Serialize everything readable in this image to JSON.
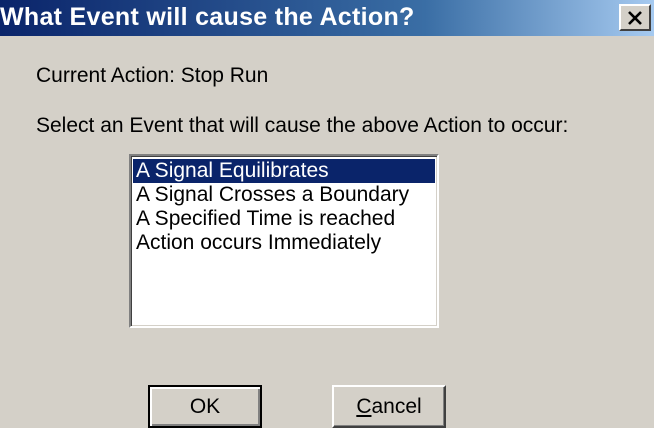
{
  "window": {
    "title": "What Event will cause the Action?",
    "close_icon": "close-icon"
  },
  "dialog": {
    "current_action": "Current Action: Stop Run",
    "select_prompt": "Select an Event that will cause the above Action to occur:"
  },
  "event_list": {
    "selected_index": 0,
    "items": [
      {
        "label": "A Signal Equilibrates"
      },
      {
        "label": "A Signal Crosses a Boundary"
      },
      {
        "label": "A Specified Time is reached"
      },
      {
        "label": "Action occurs Immediately"
      }
    ]
  },
  "buttons": {
    "ok_label": "OK",
    "cancel_mnemonic": "C",
    "cancel_rest": "ancel"
  },
  "colors": {
    "titlebar_start": "#0a246a",
    "titlebar_end": "#a6caf0",
    "selection": "#0a246a",
    "face": "#d4d0c8"
  }
}
